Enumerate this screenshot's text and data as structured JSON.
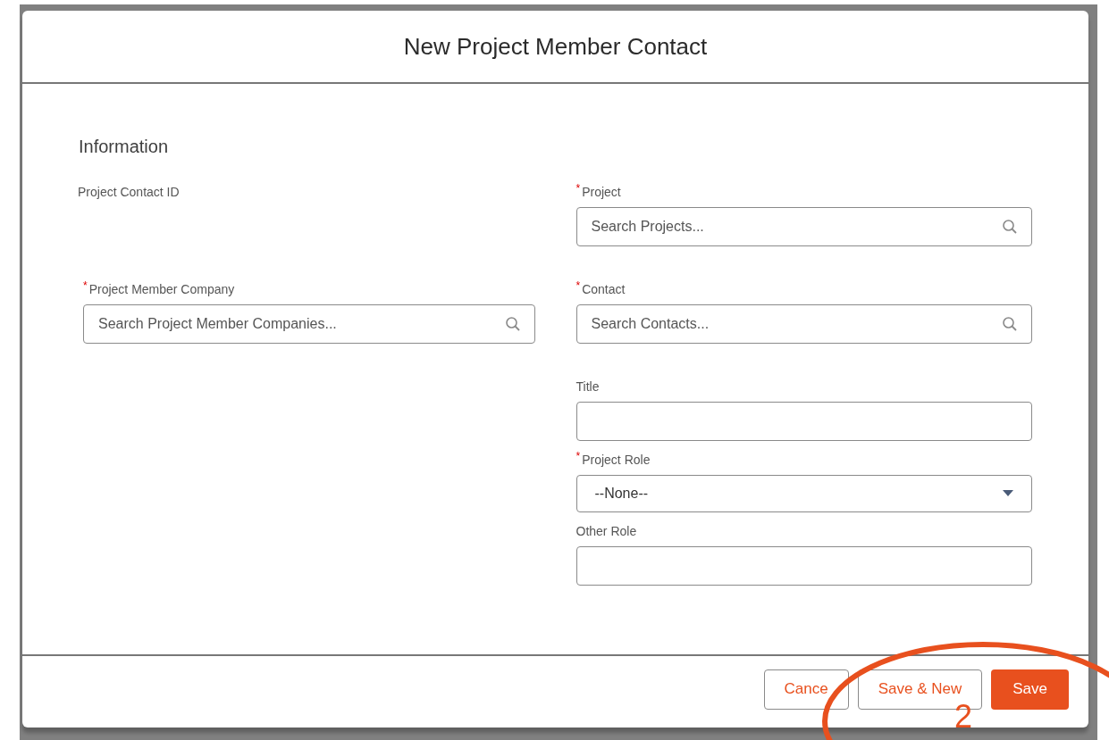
{
  "modal": {
    "title": "New Project Member Contact",
    "section": "Information",
    "rows": [
      {
        "left": {
          "kind": "readonly",
          "label": "Project Contact ID"
        },
        "right": {
          "kind": "lookup",
          "label": "Project",
          "required_mark": "*",
          "placeholder": "Search Projects..."
        }
      },
      {
        "left": {
          "kind": "lookup",
          "label": "Project Member Company",
          "required_mark": "*",
          "placeholder": "Search Project Member Companies..."
        },
        "right": {
          "kind": "lookup",
          "label": "Contact",
          "required_mark": "*",
          "placeholder": "Search Contacts..."
        }
      },
      {
        "right": {
          "kind": "text",
          "label": "Title"
        }
      },
      {
        "right": {
          "kind": "picklist",
          "label": "Project Role",
          "required_mark": "*",
          "value": "--None--"
        }
      },
      {
        "right": {
          "kind": "text",
          "label": "Other Role"
        }
      }
    ]
  },
  "buttons": [
    {
      "label": "Cance",
      "kind": "neutral"
    },
    {
      "label": "Save & New",
      "kind": "neutral"
    },
    {
      "label": "Save",
      "kind": "brand"
    }
  ],
  "annotation": {
    "number": "2"
  }
}
